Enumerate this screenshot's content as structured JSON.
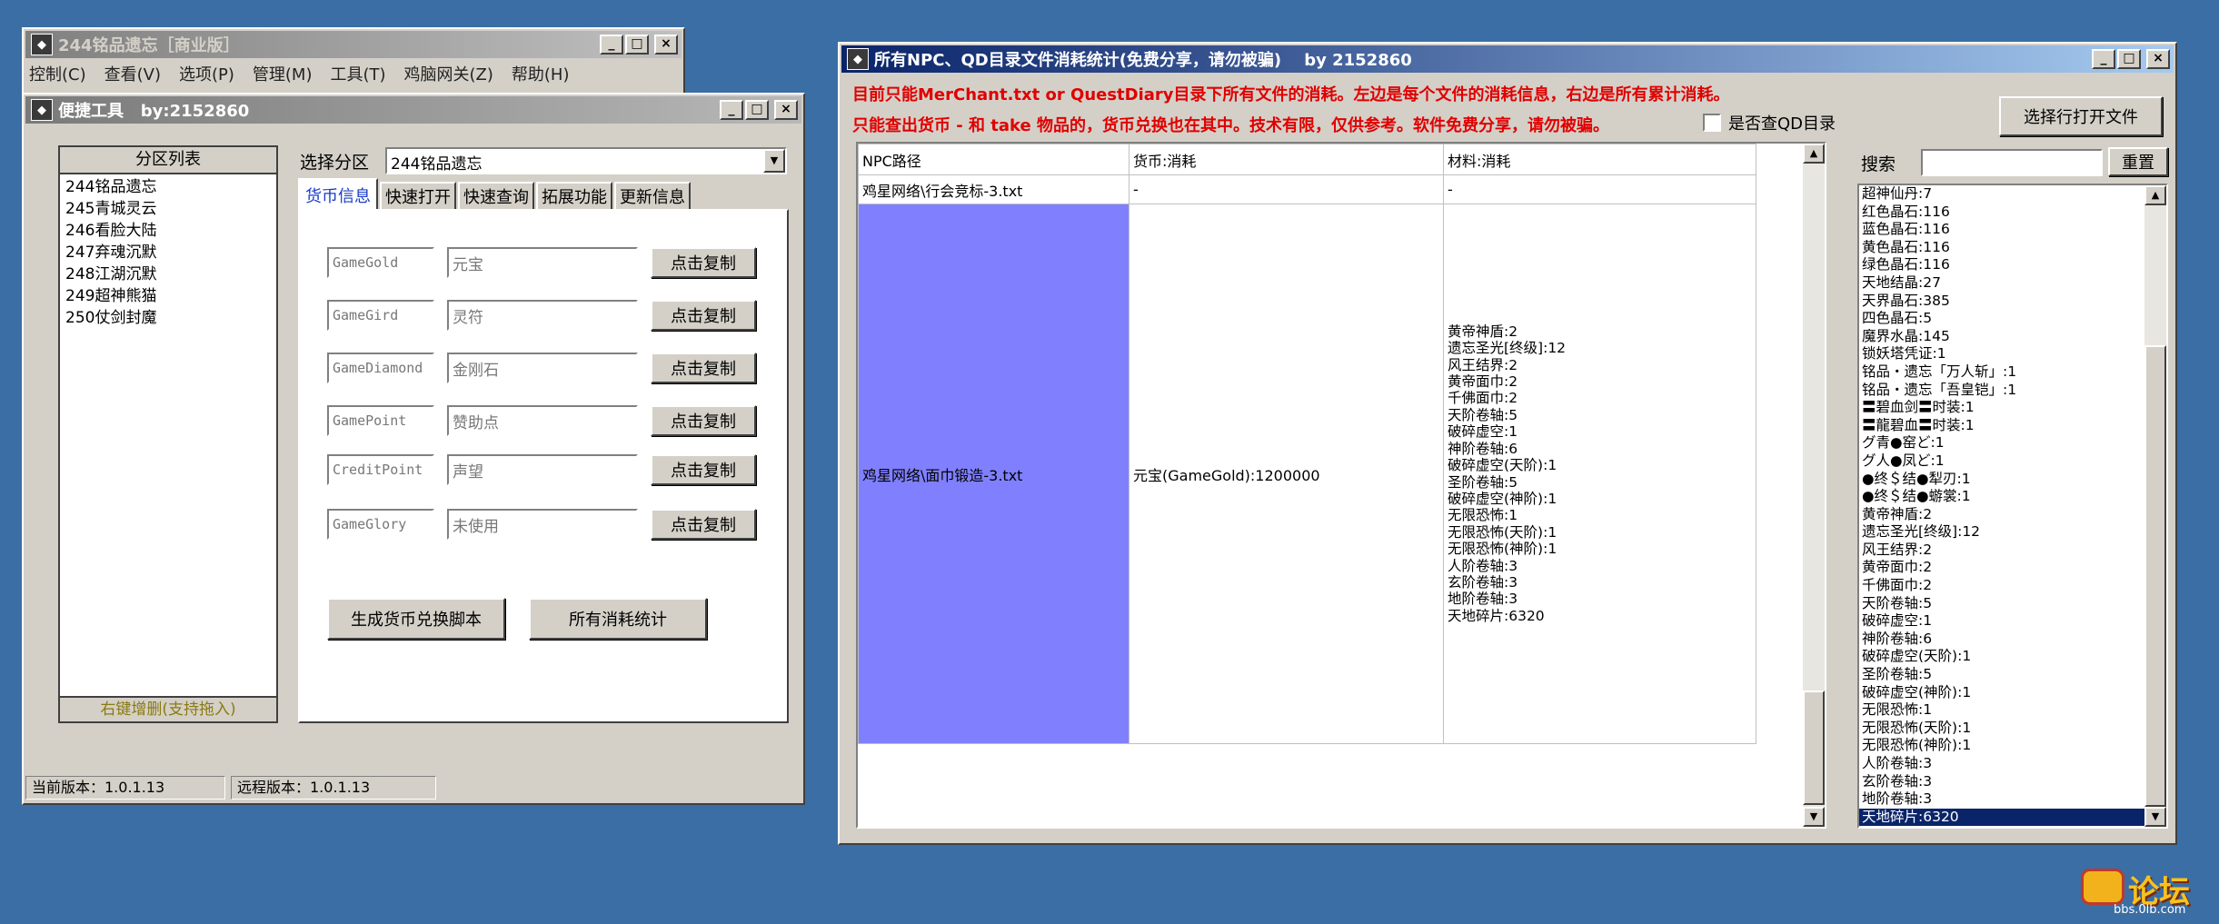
{
  "back_window": {
    "title": "244铭品遗忘［商业版］",
    "menu": [
      "控制(C)",
      "查看(V)",
      "选项(P)",
      "管理(M)",
      "工具(T)",
      "鸡脑网关(Z)",
      "帮助(H)"
    ]
  },
  "tool_window": {
    "title": "便捷工具   by:2152860",
    "partition_list": {
      "header": "分区列表",
      "items": [
        "244铭品遗忘",
        "245青城灵云",
        "246看脸大陆",
        "247弃魂沉默",
        "248江湖沉默",
        "249超神熊猫",
        "250仗剑封魔"
      ],
      "footer": "右键增删(支持拖入)"
    },
    "select_label": "选择分区",
    "select_value": "244铭品遗忘",
    "tabs": [
      "货币信息",
      "快速打开",
      "快速查询",
      "拓展功能",
      "更新信息"
    ],
    "currency_rows": [
      {
        "code": "GameGold",
        "name": "元宝",
        "button": "点击复制"
      },
      {
        "code": "GameGird",
        "name": "灵符",
        "button": "点击复制"
      },
      {
        "code": "GameDiamond",
        "name": "金刚石",
        "button": "点击复制"
      },
      {
        "code": "GamePoint",
        "name": "赞助点",
        "button": "点击复制"
      },
      {
        "code": "CreditPoint",
        "name": "声望",
        "button": "点击复制"
      },
      {
        "code": "GameGlory",
        "name": "未使用",
        "button": "点击复制"
      }
    ],
    "gen_script_button": "生成货币兑换脚本",
    "all_stats_button": "所有消耗统计",
    "status_current": "当前版本：1.0.1.13",
    "status_remote": "远程版本：1.0.1.13"
  },
  "stats_window": {
    "title": "所有NPC、QD目录文件消耗统计(免费分享，请勿被骗)    by 2152860",
    "notice1": "目前只能MerChant.txt or QuestDiary目录下所有文件的消耗。左边是每个文件的消耗信息，右边是所有累计消耗。",
    "notice2": "只能查出货币 - 和 take 物品的，货币兑换也在其中。技术有限，仅供参考。软件免费分享，请勿被骗。",
    "qd_checkbox_label": "是否查QD目录",
    "open_file_button": "选择行打开文件",
    "search_label": "搜索",
    "search_value": "",
    "reset_button": "重置",
    "table": {
      "headers": [
        "NPC路径",
        "货币:消耗",
        "材料:消耗"
      ],
      "rows": [
        {
          "path": "鸡星网络\\行会竞标-3.txt",
          "currency": "-",
          "materials": [
            "-"
          ]
        },
        {
          "path": "鸡星网络\\面巾锻造-3.txt",
          "currency": "元宝(GameGold):1200000",
          "materials": [
            "黄帝神盾:2",
            "遗忘圣光[终级]:12",
            "风王结界:2",
            "黄帝面巾:2",
            "千佛面巾:2",
            "天阶卷轴:5",
            "破碎虚空:1",
            "神阶卷轴:6",
            "破碎虚空(天阶):1",
            "圣阶卷轴:5",
            "破碎虚空(神阶):1",
            "无限恐怖:1",
            "无限恐怖(天阶):1",
            "无限恐怖(神阶):1",
            "人阶卷轴:3",
            "玄阶卷轴:3",
            "地阶卷轴:3",
            "天地碎片:6320"
          ]
        }
      ]
    },
    "totals": [
      "超神仙丹:7",
      "红色晶石:116",
      "蓝色晶石:116",
      "黄色晶石:116",
      "绿色晶石:116",
      "天地结晶:27",
      "天界晶石:385",
      "四色晶石:5",
      "魔界水晶:145",
      "锁妖塔凭证:1",
      "铭品・遗忘「万人斩」:1",
      "铭品・遗忘「吾皇铠」:1",
      "〓碧血剑〓时装:1",
      "〓龍碧血〓时装:1",
      "グ青●窑ど:1",
      "グ人●凤ど:1",
      "●终＄结●犁刃:1",
      "●终＄结●蝣裳:1",
      "黄帝神盾:2",
      "遗忘圣光[终级]:12",
      "风王结界:2",
      "黄帝面巾:2",
      "千佛面巾:2",
      "天阶卷轴:5",
      "破碎虚空:1",
      "神阶卷轴:6",
      "破碎虚空(天阶):1",
      "圣阶卷轴:5",
      "破碎虚空(神阶):1",
      "无限恐怖:1",
      "无限恐怖(天阶):1",
      "无限恐怖(神阶):1",
      "人阶卷轴:3",
      "玄阶卷轴:3",
      "地阶卷轴:3",
      "天地碎片:6320"
    ]
  },
  "watermark": {
    "text": "论坛",
    "url": "bbs.0lb.com"
  },
  "colors": {
    "desktop": "#3a6ea5",
    "title_active": "#0a246a",
    "selected_cell": "#8080ff",
    "notice_red": "#e00000"
  }
}
